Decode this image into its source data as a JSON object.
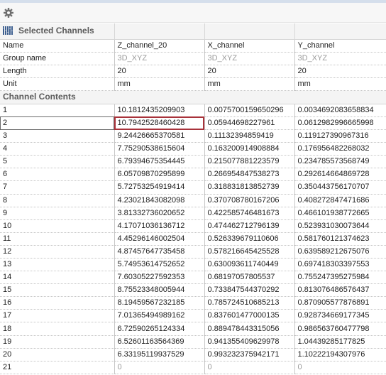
{
  "toolbar": {
    "icon": "gear-icon"
  },
  "section_selected": {
    "title": "Selected Channels",
    "icon": "channels-icon"
  },
  "properties": [
    {
      "label": "Name",
      "values": [
        "Z_channel_20",
        "X_channel",
        "Y_channel"
      ],
      "muted": false
    },
    {
      "label": "Group name",
      "values": [
        "3D_XYZ",
        "3D_XYZ",
        "3D_XYZ"
      ],
      "muted": true
    },
    {
      "label": "Length",
      "values": [
        "20",
        "20",
        "20"
      ],
      "muted": false
    },
    {
      "label": "Unit",
      "values": [
        "mm",
        "mm",
        "mm"
      ],
      "muted": false
    }
  ],
  "section_contents": {
    "title": "Channel Contents"
  },
  "selected_row_index": 1,
  "contents": [
    {
      "index": "1",
      "values": [
        "10.1812435209903",
        "0.0075700159650296",
        "0.0034692083658834"
      ]
    },
    {
      "index": "2",
      "values": [
        "10.7942528460428",
        "0.05944698227961",
        "0.0612982996665998"
      ]
    },
    {
      "index": "3",
      "values": [
        "9.24426665370581",
        "0.11132394859419",
        "0.119127390967316"
      ]
    },
    {
      "index": "4",
      "values": [
        "7.75290538615604",
        "0.163200914908884",
        "0.176956482268032"
      ]
    },
    {
      "index": "5",
      "values": [
        "6.79394675354445",
        "0.215077881223579",
        "0.234785573568749"
      ]
    },
    {
      "index": "6",
      "values": [
        "6.05709870295899",
        "0.266954847538273",
        "0.292614664869728"
      ]
    },
    {
      "index": "7",
      "values": [
        "5.72753254919414",
        "0.318831813852739",
        "0.350443756170707"
      ]
    },
    {
      "index": "8",
      "values": [
        "4.23021843082098",
        "0.370708780167206",
        "0.408272847471686"
      ]
    },
    {
      "index": "9",
      "values": [
        "3.81332736020652",
        "0.422585746481673",
        "0.466101938772665"
      ]
    },
    {
      "index": "10",
      "values": [
        "4.17071036136712",
        "0.474462712796139",
        "0.523931030073644"
      ]
    },
    {
      "index": "11",
      "values": [
        "4.45296146002504",
        "0.526339679110606",
        "0.581760121374623"
      ]
    },
    {
      "index": "12",
      "values": [
        "4.87457647735458",
        "0.578216645425528",
        "0.639589212675076"
      ]
    },
    {
      "index": "13",
      "values": [
        "5.74953614752652",
        "0.630093611740449",
        "0.697418303397553"
      ]
    },
    {
      "index": "14",
      "values": [
        "7.60305227592353",
        "0.68197057805537",
        "0.755247395275984"
      ]
    },
    {
      "index": "15",
      "values": [
        "8.75523348005944",
        "0.733847544370292",
        "0.813076486576437"
      ]
    },
    {
      "index": "16",
      "values": [
        "8.19459567232185",
        "0.785724510685213",
        "0.870905577876891"
      ]
    },
    {
      "index": "17",
      "values": [
        "7.01365494989162",
        "0.837601477000135",
        "0.928734669177345"
      ]
    },
    {
      "index": "18",
      "values": [
        "6.72590265124334",
        "0.889478443315056",
        "0.986563760477798"
      ]
    },
    {
      "index": "19",
      "values": [
        "6.52601163564369",
        "0.941355409629978",
        "1.04439285177825"
      ]
    },
    {
      "index": "20",
      "values": [
        "6.33195119937529",
        "0.993232375942171",
        "1.10222194307976"
      ]
    },
    {
      "index": "21",
      "values": [
        "0",
        "0",
        "0"
      ],
      "muted": true
    }
  ]
}
